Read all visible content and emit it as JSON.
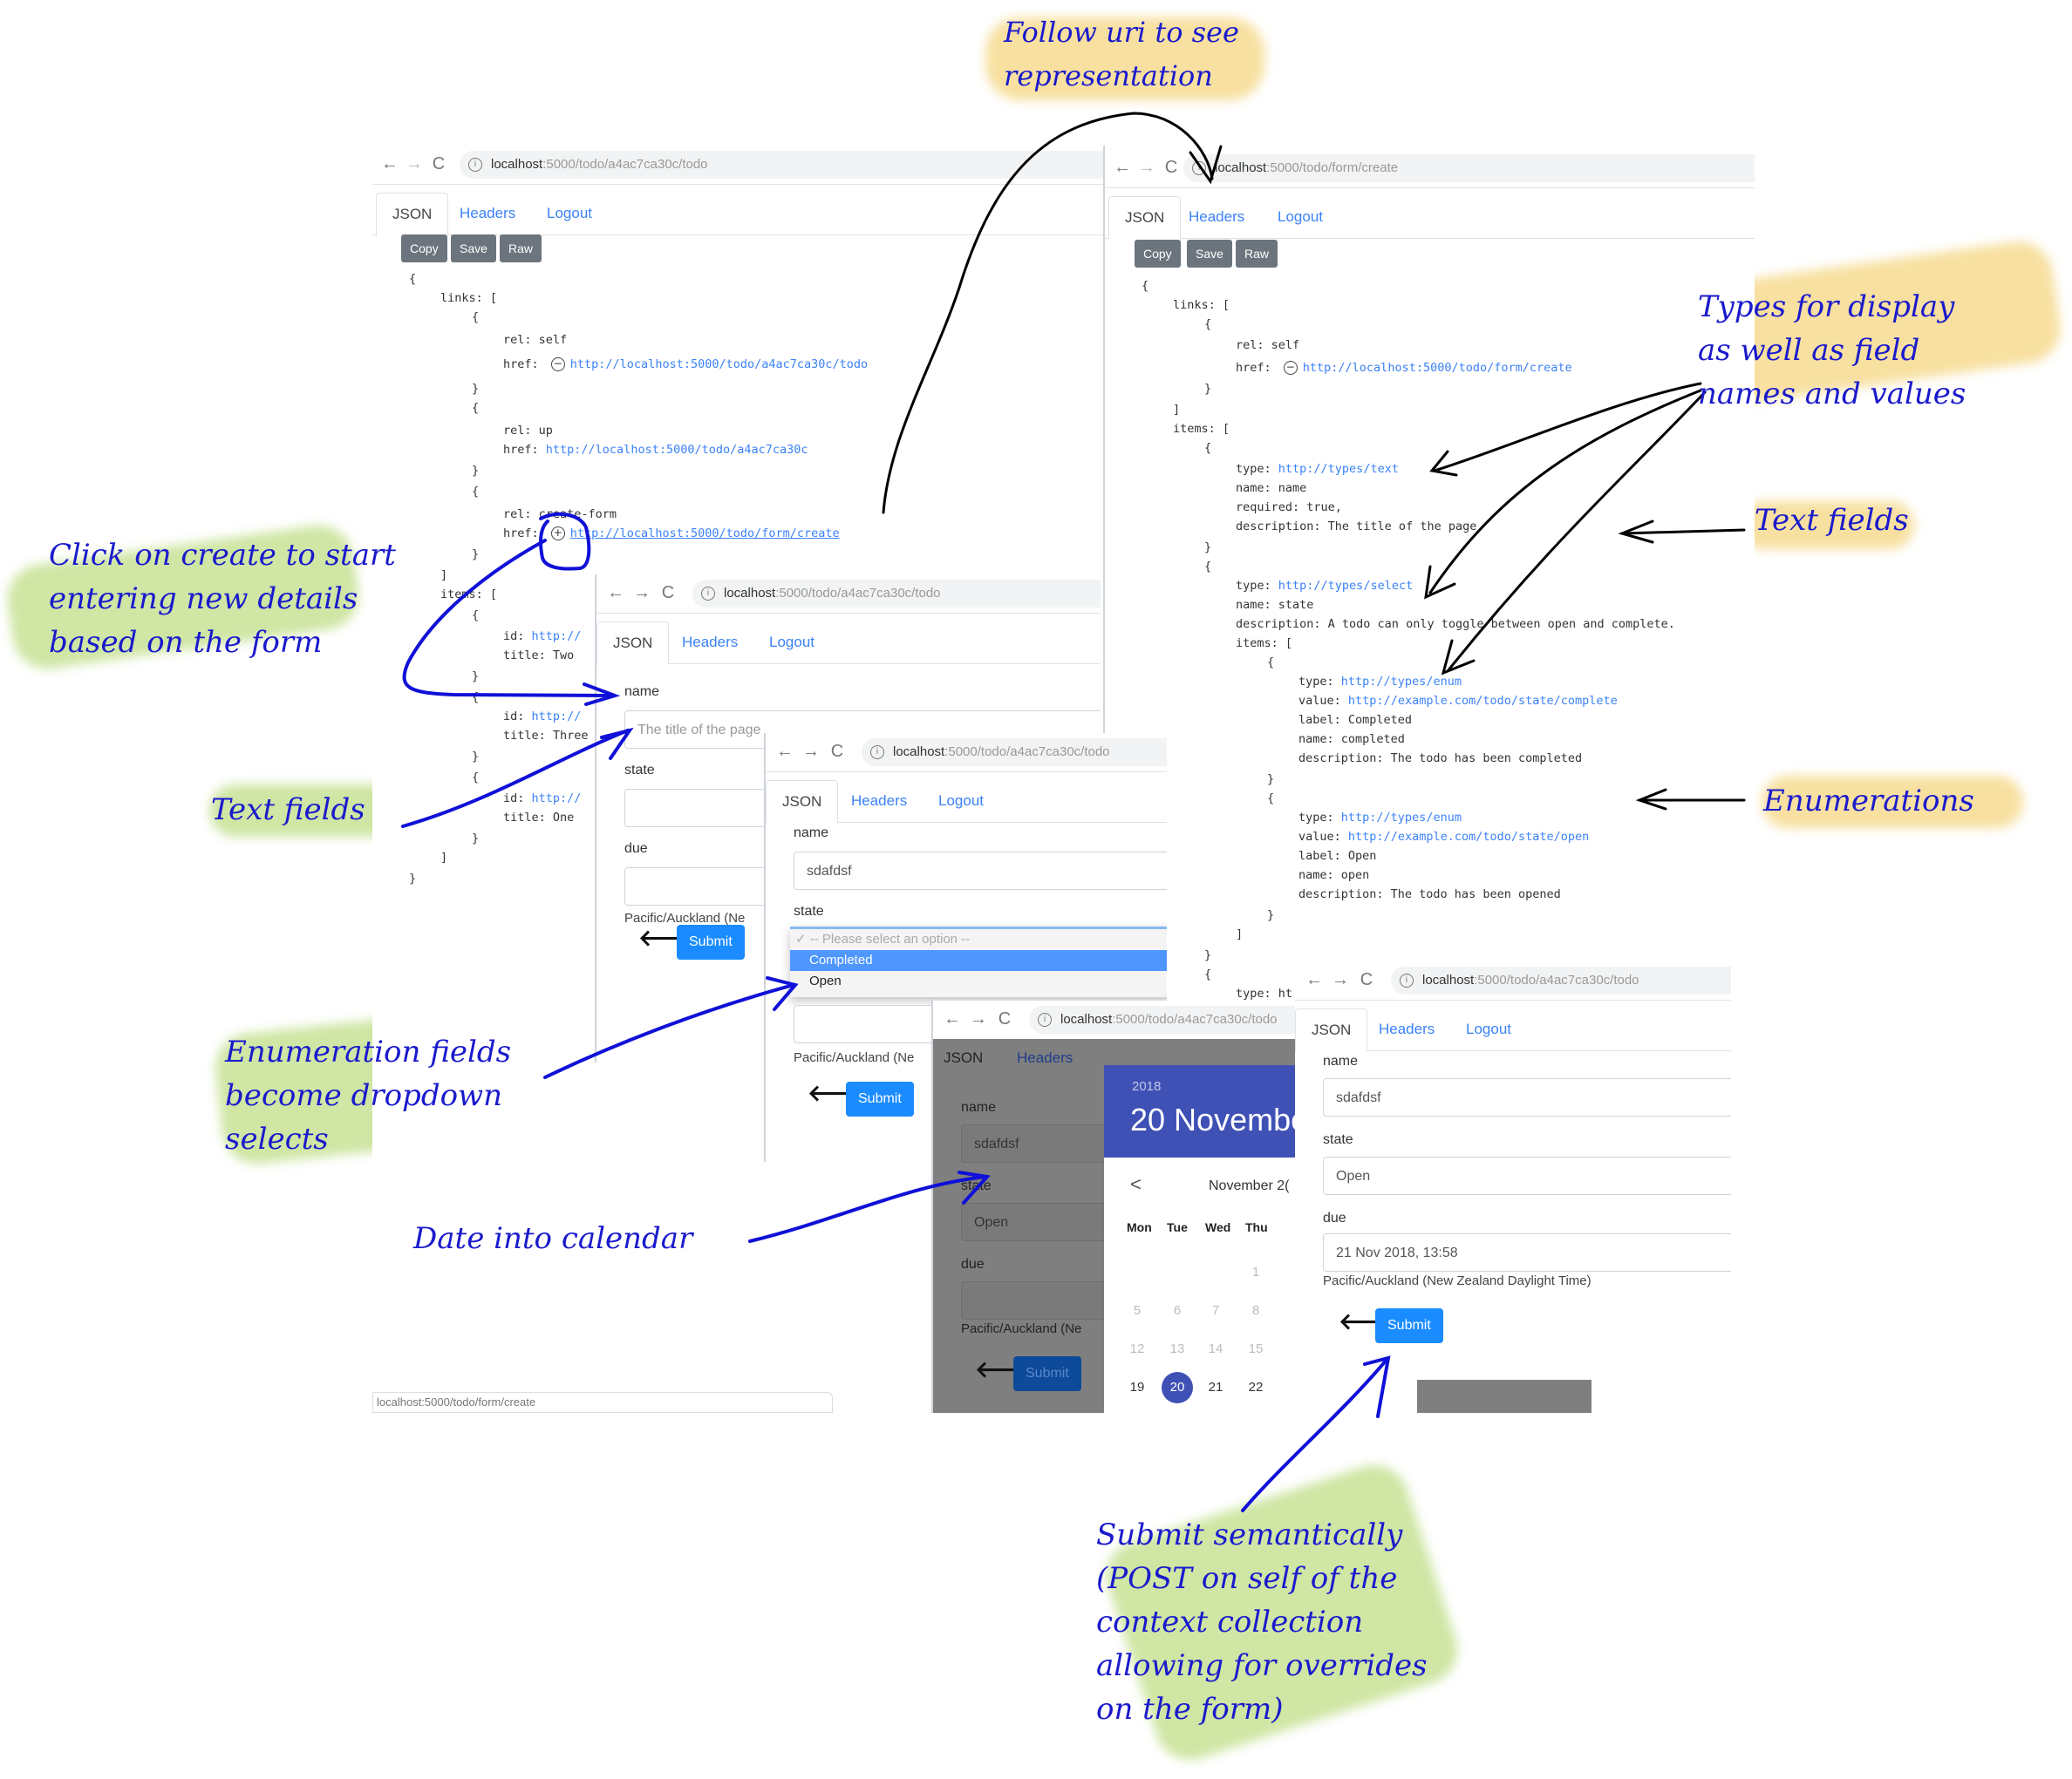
{
  "annotations": {
    "follow_uri": "Follow uri to see\nrepresentation",
    "click_create": "Click on create to start\nentering new details\nbased on the form",
    "text_fields_left": "Text fields",
    "types_display": "Types for display\nas well as field\nnames and values",
    "text_fields_right": "Text fields",
    "enumerations": "Enumerations",
    "enum_dropdown": "Enumeration fields\nbecome dropdown\nselects",
    "date_calendar": "Date into calendar",
    "submit_semantic": "Submit semantically\n(POST on self of the\ncontext collection\nallowing for overrides\non the form)"
  },
  "browser": {
    "back": "←",
    "forward": "→",
    "reload": "C",
    "info": "i",
    "tabs": {
      "json": "JSON",
      "headers": "Headers",
      "logout": "Logout"
    },
    "toolbar": {
      "copy": "Copy",
      "save": "Save",
      "raw": "Raw"
    }
  },
  "win1": {
    "url_host": "localhost",
    "url_path": ":5000/todo/a4ac7ca30c/todo",
    "status_bar": "localhost:5000/todo/form/create",
    "json": {
      "open": "{",
      "links_key": "links: [",
      "links": [
        {
          "rel": "rel: self",
          "href_label": "href:",
          "href": "http://localhost:5000/todo/a4ac7ca30c/todo",
          "icon": "minus"
        },
        {
          "rel": "rel: up",
          "href_label": "href:",
          "href": "http://localhost:5000/todo/a4ac7ca30c"
        },
        {
          "rel": "rel: create-form",
          "href_label": "href:",
          "href": "http://localhost:5000/todo/form/create",
          "icon": "plus"
        }
      ],
      "items_key": "items: [",
      "items": [
        {
          "id_label": "id:",
          "id": "http://",
          "title": "title: Two"
        },
        {
          "id_label": "id:",
          "id": "http://",
          "title": "title: Three"
        },
        {
          "id_label": "id:",
          "id": "http://",
          "title": "title: One"
        }
      ],
      "brace_open": "{",
      "brace_close": "}",
      "bracket_close": "]",
      "close": "}"
    }
  },
  "win2": {
    "url_host": "localhost",
    "url_path": ":5000/todo/form/create",
    "json": {
      "links_key": "links: [",
      "self_rel": "rel: self",
      "self_href_label": "href:",
      "self_href": "http://localhost:5000/todo/form/create",
      "items_key": "items: [",
      "field1": {
        "type_label": "type:",
        "type": "http://types/text",
        "name": "name: name",
        "required": "required: true,",
        "description": "description: The title of the page"
      },
      "field2": {
        "type_label": "type:",
        "type": "http://types/select",
        "name": "name: state",
        "description": "description: A todo can only toggle between open and complete.",
        "items_key": "items: ["
      },
      "enum1": {
        "type_label": "type:",
        "type": "http://types/enum",
        "value_label": "value:",
        "value": "http://example.com/todo/state/complete",
        "label": "label: Completed",
        "name": "name: completed",
        "description": "description: The todo has been completed"
      },
      "enum2": {
        "type_label": "type:",
        "type": "http://types/enum",
        "value_label": "value:",
        "value": "http://example.com/todo/state/open",
        "label": "label: Open",
        "name": "name: open",
        "description": "description: The todo has been opened"
      },
      "trailing_type": "type: ht"
    }
  },
  "formA": {
    "url_host": "localhost",
    "url_path": ":5000/todo/a4ac7ca30c/todo",
    "name_label": "name",
    "name_placeholder": "The title of the page",
    "state_label": "state",
    "state_value": "",
    "due_label": "due",
    "due_value": "",
    "timezone": "Pacific/Auckland (Ne",
    "submit": "Submit"
  },
  "formB": {
    "url_host": "localhost",
    "url_path": ":5000/todo/a4ac7ca30c/todo",
    "name_label": "name",
    "name_value": "sdafdsf",
    "state_label": "state",
    "dropdown": {
      "placeholder": "✓ -- Please select an option --",
      "options": [
        "Completed",
        "Open"
      ],
      "highlighted": "Completed"
    },
    "timezone": "Pacific/Auckland (Ne",
    "submit": "Submit"
  },
  "formC": {
    "url_host": "localhost",
    "url_path": ":5000/todo/a4ac7ca30c/todo",
    "name_label": "name",
    "name_value": "sdafdsf",
    "state_label": "state",
    "state_value": "Open",
    "due_label": "due",
    "timezone": "Pacific/Auckland (Ne",
    "submit": "Submit",
    "calendar": {
      "year": "2018",
      "date_heading": "20 Novembe",
      "prev": "<",
      "month_label": "November 2(",
      "weekdays": [
        "Mon",
        "Tue",
        "Wed",
        "Thu"
      ],
      "rows": [
        [
          "",
          "",
          "",
          "1"
        ],
        [
          "5",
          "6",
          "7",
          "8"
        ],
        [
          "12",
          "13",
          "14",
          "15"
        ],
        [
          "19",
          "20",
          "21",
          "22"
        ]
      ],
      "selected": "20"
    }
  },
  "formD": {
    "url_host": "localhost",
    "url_path": ":5000/todo/a4ac7ca30c/todo",
    "name_label": "name",
    "name_value": "sdafdsf",
    "state_label": "state",
    "state_value": "Open",
    "due_label": "due",
    "due_value": "21 Nov 2018, 13:58",
    "timezone": "Pacific/Auckland (New Zealand Daylight Time)",
    "submit": "Submit"
  }
}
